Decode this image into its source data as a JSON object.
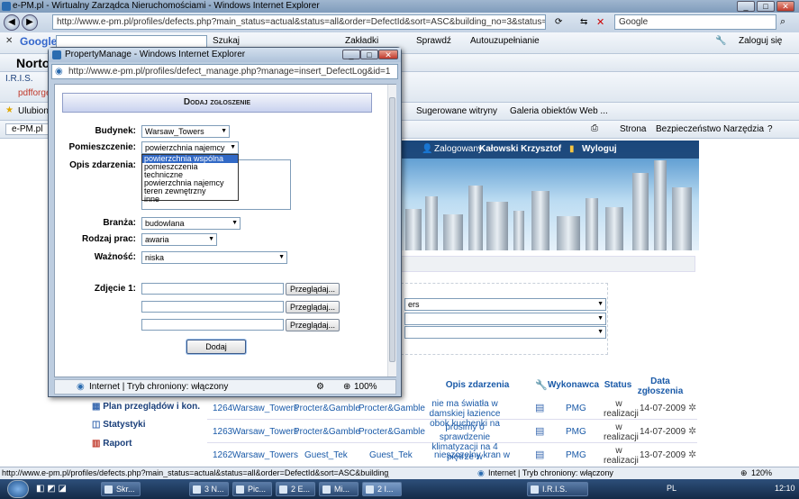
{
  "main_window": {
    "title": "e-PM.pl - Wirtualny Zarządca Nieruchomościami - Windows Internet Explorer",
    "url": "http://www.e-pm.pl/profiles/defects.php?main_status=actual&status=all&order=DefectId&sort=ASC&building_no=3&status=all&workneed=&p",
    "search_placeholder": "Google"
  },
  "google_toolbar": {
    "logo": "Google",
    "search_label": "Szukaj",
    "bookmarks_label": "Zakładki",
    "spell_label": "Sprawdź",
    "autofill_label": "Autouzupełnianie",
    "login_label": "Zaloguj się"
  },
  "norton": {
    "logo": "Norto"
  },
  "links_bar": {
    "iris": "I.R.I.S.",
    "pdf": "pdfforge"
  },
  "favorites_bar": {
    "favorites": "Ulubione",
    "suggested": "Sugerowane witryny",
    "gallery": "Galeria obiektów Web ..."
  },
  "tab": {
    "label": "e-PM.pl"
  },
  "command_bar": {
    "page": "Strona",
    "security": "Bezpieczeństwo",
    "tools": "Narzędzia"
  },
  "site": {
    "logged_label": "Zalogowany",
    "user": "Kałowski Krzysztof",
    "logout": "Wyloguj",
    "filter_value": "ers"
  },
  "sidebar": {
    "items": [
      "Plan przeglądów i kon.",
      "Statystyki",
      "Raport"
    ]
  },
  "table": {
    "headers": [
      "Opis zdarzenia",
      "Wykonawca",
      "Status",
      "Data zgłoszenia"
    ],
    "rows": [
      {
        "id": "1264",
        "building": "Warsaw_Towers",
        "tenant": "Procter&Gamble",
        "room": "Procter&Gamble",
        "desc": "nie ma światła w damskiej łazience obok kuchenki na",
        "contractor": "PMG",
        "status": "w realizacji",
        "date": "14-07-2009"
      },
      {
        "id": "1263",
        "building": "Warsaw_Towers",
        "tenant": "Procter&Gamble",
        "room": "Procter&Gamble",
        "desc": "prosimy o sprawdzenie klimatyzacji na 4 piętrze w",
        "contractor": "PMG",
        "status": "w realizacji",
        "date": "14-07-2009"
      },
      {
        "id": "1262",
        "building": "Warsaw_Towers",
        "tenant": "Guest_Tek",
        "room": "Guest_Tek",
        "desc": "nieszczelny kran w",
        "contractor": "PMG",
        "status": "w realizacji",
        "date": "13-07-2009"
      }
    ]
  },
  "popup": {
    "title": "PropertyManage - Windows Internet Explorer",
    "url": "http://www.e-pm.pl/profiles/defect_manage.php?manage=insert_DefectLog&id=1",
    "form_title": "Dodaj zgłoszenie",
    "building_label": "Budynek:",
    "building_value": "Warsaw_Towers",
    "room_label": "Pomieszczenie:",
    "room_value": "powierzchnia najemcy",
    "room_options": [
      "powierzchnia wspólna",
      "pomieszczenia techniczne",
      "powierzchnia najemcy",
      "teren zewnętrzny",
      "inne"
    ],
    "desc_label": "Opis zdarzenia:",
    "branch_label": "Branża:",
    "branch_value": "budowlana",
    "worktype_label": "Rodzaj prac:",
    "worktype_value": "awaria",
    "priority_label": "Ważność:",
    "priority_value": "niska",
    "photo_label": "Zdjęcie 1:",
    "browse_label": "Przeglądaj...",
    "add_label": "Dodaj",
    "status_zone": "Internet | Tryb chroniony: włączony",
    "zoom": "100%"
  },
  "status_bar": {
    "url": "http://www.e-pm.pl/profiles/defects.php?main_status=actual&status=all&order=DefectId&sort=ASC&building_no",
    "zone": "Internet | Tryb chroniony: włączony",
    "zoom": "120%"
  },
  "taskbar": {
    "tasks": [
      "Skr...",
      "3 N...",
      "Pic...",
      "2 E...",
      "Mi...",
      "2 I...",
      "I.R.I.S."
    ],
    "lang": "PL",
    "clock": "12:10"
  }
}
